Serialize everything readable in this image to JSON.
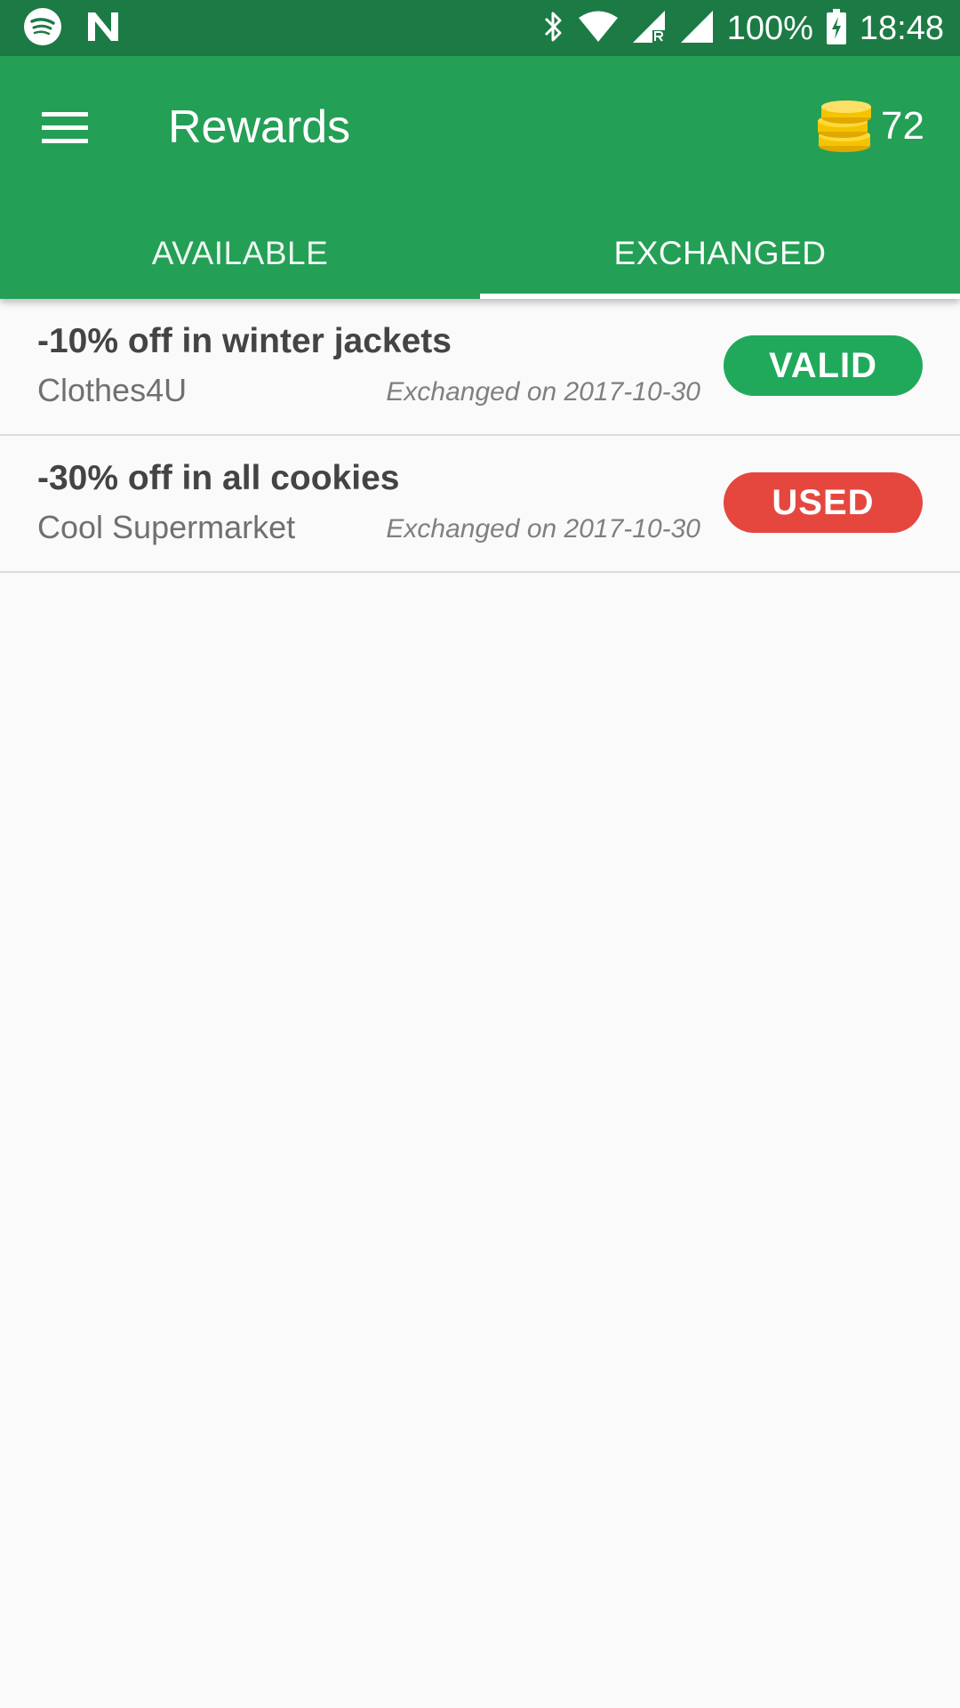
{
  "status_bar": {
    "battery": "100%",
    "time": "18:48",
    "icons": [
      "spotify-icon",
      "n-app-icon",
      "bluetooth-icon",
      "wifi-icon",
      "signal-roaming-icon",
      "signal-icon",
      "battery-charging-icon"
    ]
  },
  "app_bar": {
    "title": "Rewards",
    "menu_icon": "hamburger-menu-icon",
    "coin_icon": "gold-coins-icon",
    "coin_count": "72"
  },
  "tabs": [
    {
      "label": "AVAILABLE",
      "selected": false
    },
    {
      "label": "EXCHANGED",
      "selected": true
    }
  ],
  "rewards": [
    {
      "title": "-10% off in winter jackets",
      "merchant": "Clothes4U",
      "date": "Exchanged on 2017-10-30",
      "status": "VALID",
      "status_color": "#21a95b"
    },
    {
      "title": "-30% off in all cookies",
      "merchant": "Cool Supermarket",
      "date": "Exchanged on 2017-10-30",
      "status": "USED",
      "status_color": "#e5473f"
    }
  ],
  "colors": {
    "status_bar": "#1c7a45",
    "primary": "#249f56",
    "background": "#fafafa"
  }
}
